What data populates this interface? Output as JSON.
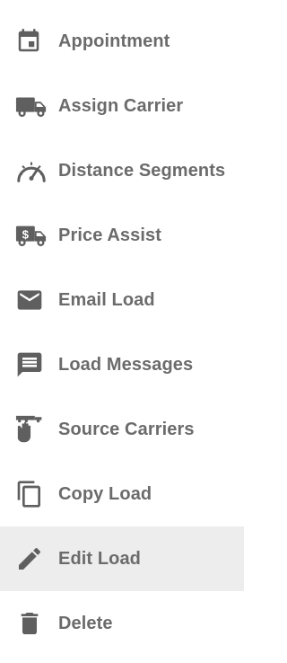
{
  "menu": {
    "items": [
      {
        "label": "Appointment",
        "icon": "calendar-icon"
      },
      {
        "label": "Assign Carrier",
        "icon": "truck-icon"
      },
      {
        "label": "Distance Segments",
        "icon": "speedometer-icon"
      },
      {
        "label": "Price Assist",
        "icon": "dollar-truck-icon"
      },
      {
        "label": "Email Load",
        "icon": "envelope-icon"
      },
      {
        "label": "Load Messages",
        "icon": "message-icon"
      },
      {
        "label": "Source Carriers",
        "icon": "hand-truck-icon"
      },
      {
        "label": "Copy Load",
        "icon": "copy-icon"
      },
      {
        "label": "Edit Load",
        "icon": "pencil-icon",
        "state": "highlighted"
      },
      {
        "label": "Delete",
        "icon": "trash-icon"
      }
    ]
  },
  "colors": {
    "icon": "#5f5f5f",
    "text": "#6b6b6b",
    "highlight_bg": "#ededed",
    "background": "#ffffff"
  }
}
